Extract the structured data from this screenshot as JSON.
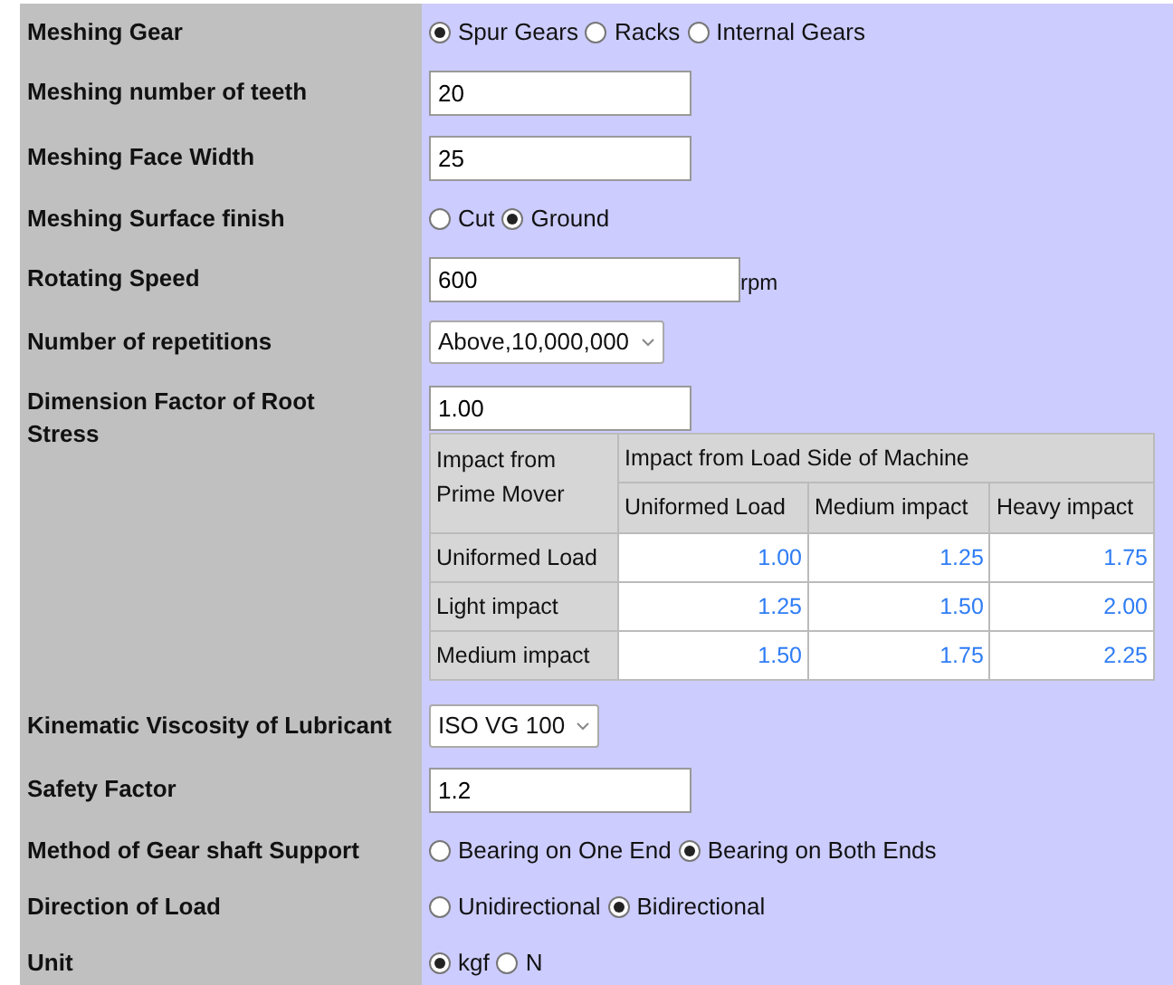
{
  "rows": [
    {
      "kind": "radio",
      "label": "Meshing Gear",
      "options": [
        {
          "label": "Spur Gears",
          "selected": true
        },
        {
          "label": "Racks",
          "selected": false
        },
        {
          "label": "Internal Gears",
          "selected": false
        }
      ]
    },
    {
      "kind": "input",
      "label": "Meshing number of teeth",
      "value": "20"
    },
    {
      "kind": "input",
      "label": "Meshing Face Width",
      "value": "25"
    },
    {
      "kind": "radio",
      "label": "Meshing Surface finish",
      "options": [
        {
          "label": "Cut",
          "selected": false
        },
        {
          "label": "Ground",
          "selected": true
        }
      ]
    },
    {
      "kind": "input",
      "label": "Rotating Speed",
      "value": "600",
      "unit": "rpm"
    },
    {
      "kind": "select",
      "label": "Number of repetitions",
      "value": "Above,10,000,000"
    },
    {
      "kind": "table",
      "label": "Dimension Factor of Root Stress",
      "value": "1.00",
      "table": {
        "corner": "Impact from Prime Mover",
        "group_header": "Impact from Load Side of Machine",
        "columns": [
          "Uniformed Load",
          "Medium impact",
          "Heavy impact"
        ],
        "rows": [
          {
            "label": "Uniformed Load",
            "cells": [
              "1.00",
              "1.25",
              "1.75"
            ]
          },
          {
            "label": "Light impact",
            "cells": [
              "1.25",
              "1.50",
              "2.00"
            ]
          },
          {
            "label": "Medium impact",
            "cells": [
              "1.50",
              "1.75",
              "2.25"
            ]
          }
        ]
      }
    },
    {
      "kind": "select",
      "label": "Kinematic Viscosity of Lubricant",
      "value": "ISO VG 100"
    },
    {
      "kind": "input",
      "label": "Safety Factor",
      "value": "1.2"
    },
    {
      "kind": "radio",
      "label": "Method of Gear shaft Support",
      "options": [
        {
          "label": "Bearing on One End",
          "selected": false
        },
        {
          "label": "Bearing on Both Ends",
          "selected": true
        }
      ]
    },
    {
      "kind": "radio",
      "label": "Direction of Load",
      "options": [
        {
          "label": "Unidirectional",
          "selected": false
        },
        {
          "label": "Bidirectional",
          "selected": true
        }
      ]
    },
    {
      "kind": "radio",
      "label": "Unit",
      "options": [
        {
          "label": "kgf",
          "selected": true
        },
        {
          "label": "N",
          "selected": false
        }
      ]
    }
  ]
}
